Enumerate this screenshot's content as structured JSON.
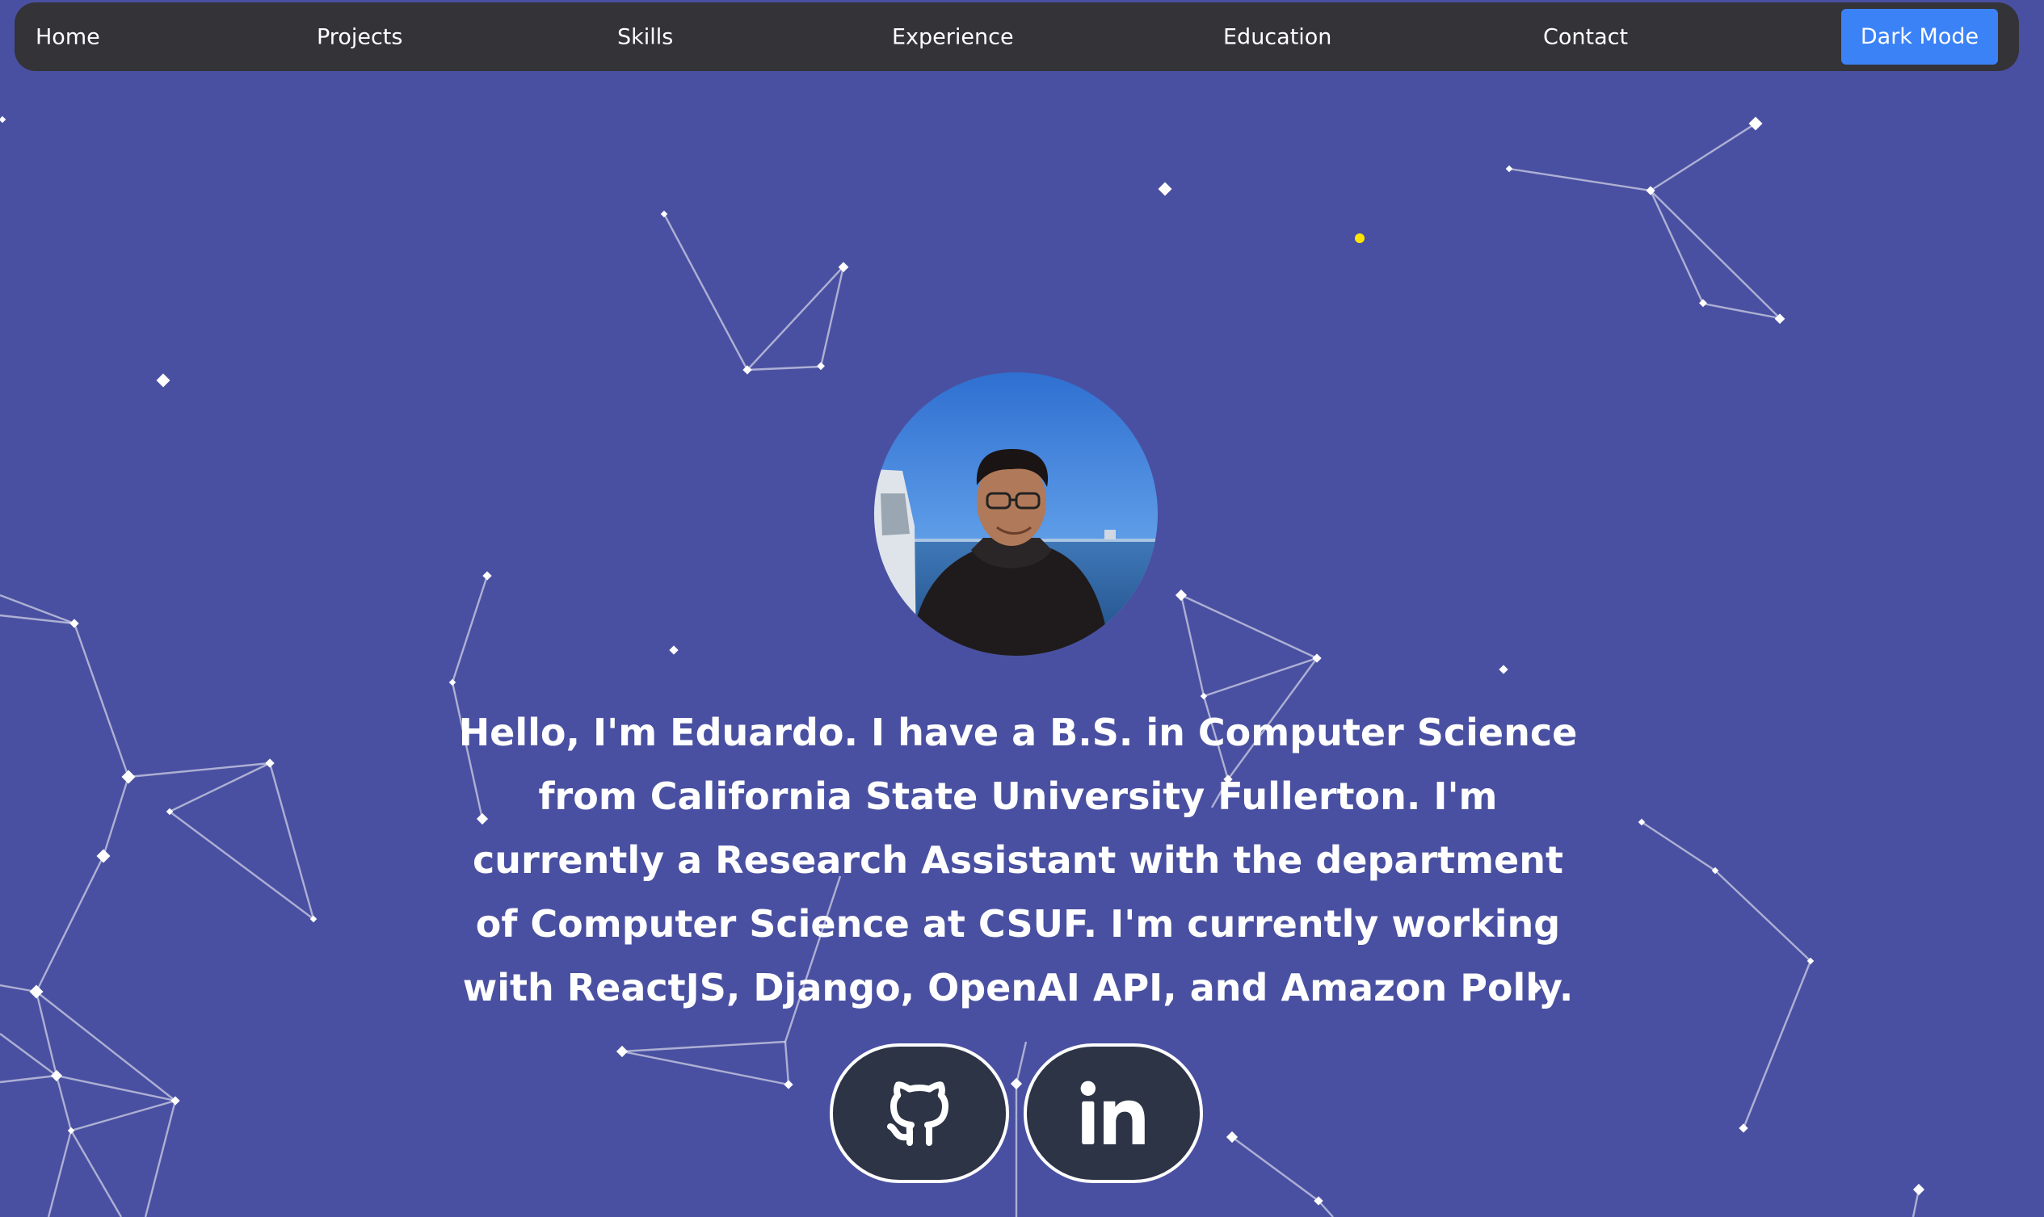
{
  "nav": {
    "items": [
      {
        "label": "Home"
      },
      {
        "label": "Projects"
      },
      {
        "label": "Skills"
      },
      {
        "label": "Experience"
      },
      {
        "label": "Education"
      },
      {
        "label": "Contact"
      }
    ],
    "theme_toggle_label": "Dark Mode"
  },
  "hero": {
    "avatar_icon": "profile-photo",
    "intro_text": "Hello, I'm Eduardo. I have a B.S. in Computer Science from California State University Fullerton. I'm currently a Research Assistant with the department of Computer Science at CSUF. I'm currently working with ReactJS, Django, OpenAI API, and Amazon Polly."
  },
  "social": {
    "github_icon": "github-icon",
    "linkedin_icon": "linkedin-icon"
  },
  "colors": {
    "background": "#4a50a1",
    "navbar": "#333338",
    "accent_button": "#3b82f6",
    "social_button": "#2d3446",
    "highlight_dot": "#ffe600"
  }
}
